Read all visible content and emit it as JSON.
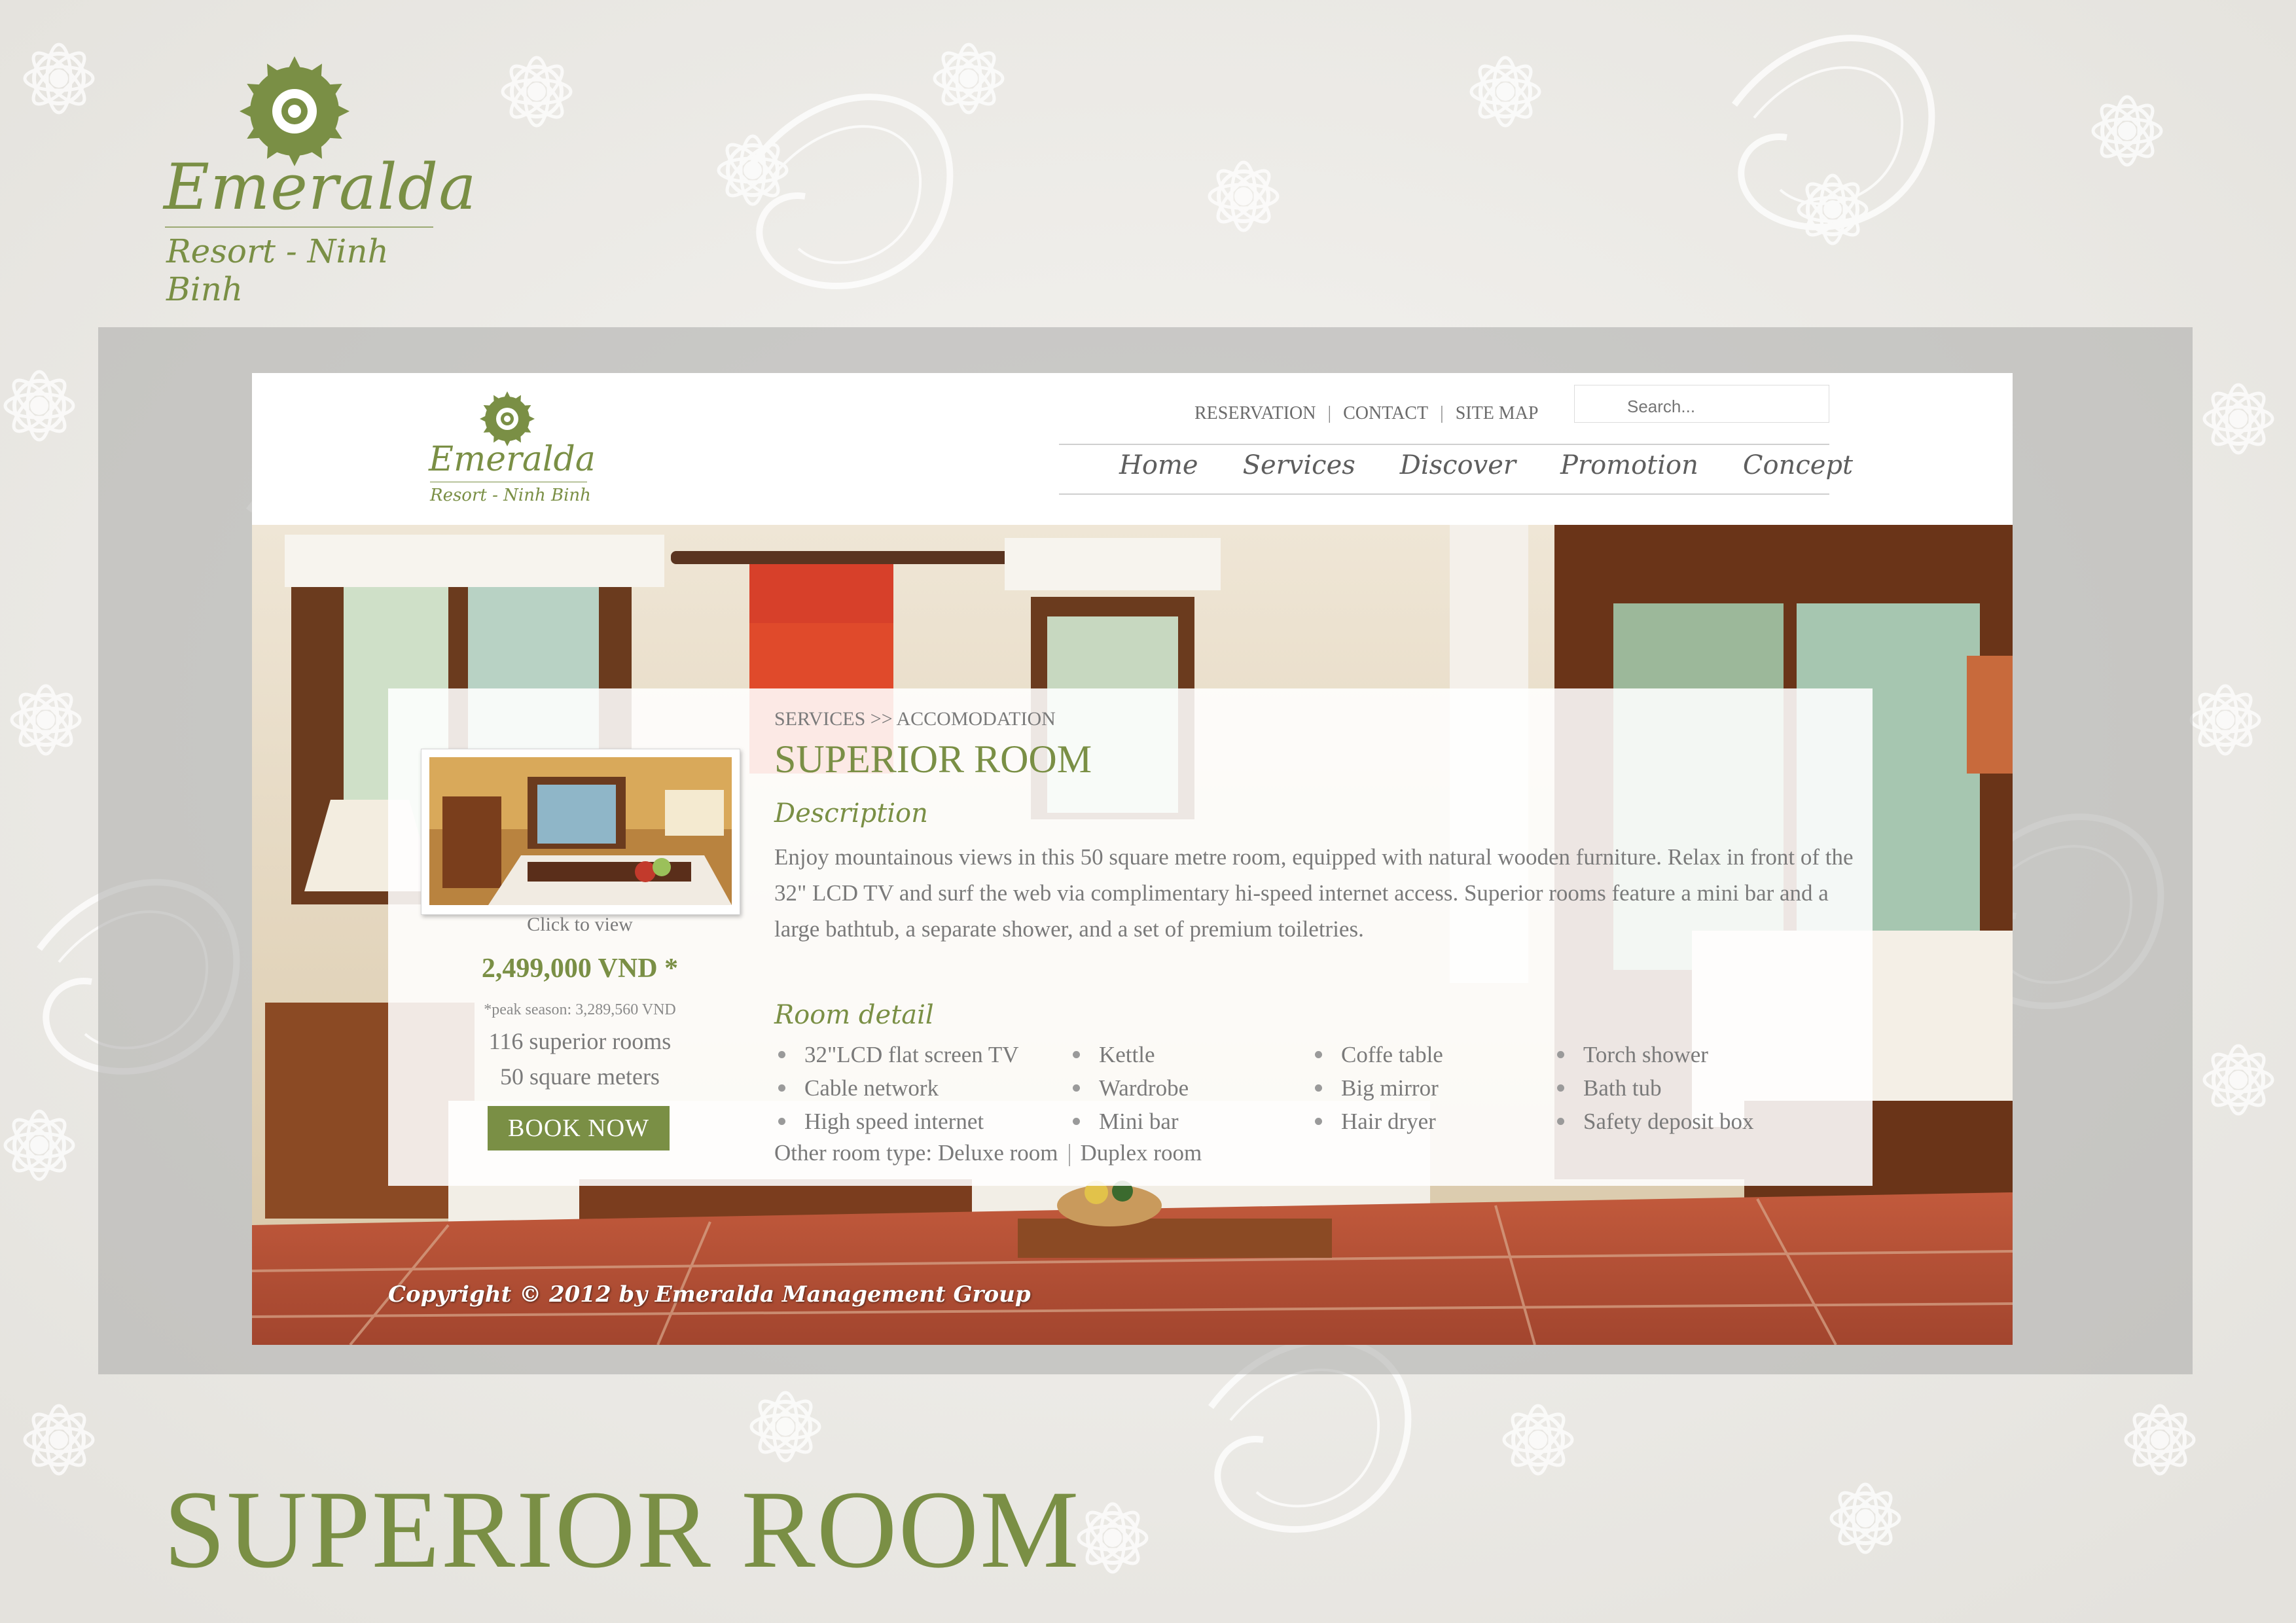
{
  "slide": {
    "brand_name": "Emeralda",
    "brand_sub": "Resort - Ninh Binh",
    "title": "SUPERIOR ROOM"
  },
  "colors": {
    "accent": "#7a8f45",
    "text": "#7a7a7a",
    "frame": "#b8b8b6"
  },
  "site": {
    "logo": {
      "brand": "Emeralda",
      "sub": "Resort - Ninh Binh"
    },
    "top_links": [
      "RESERVATION",
      "CONTACT",
      "SITE MAP"
    ],
    "search_placeholder": "Search...",
    "nav": [
      "Home",
      "Services",
      "Discover",
      "Promotion",
      "Concept"
    ],
    "breadcrumb": "SERVICES >> ACCOMODATION",
    "room": {
      "title": "SUPERIOR ROOM",
      "click_to_view": "Click to view",
      "price": "2,499,000 VND *",
      "peak_note": "*peak season: 3,289,560 VND",
      "room_count": "116 superior rooms",
      "size": "50 square meters",
      "book_label": "BOOK NOW",
      "description_heading": "Description",
      "description": "Enjoy mountainous views in this 50 square metre room, equipped with natural wooden furniture. Relax in front of the 32\" LCD TV and surf the web via complimentary hi-speed internet access. Superior rooms feature a mini bar and a large bathtub, a separate shower, and a set of premium toiletries.",
      "detail_heading": "Room detail",
      "details": [
        [
          "32\"LCD flat screen TV",
          "Cable network",
          "High speed internet"
        ],
        [
          "Kettle",
          "Wardrobe",
          "Mini bar"
        ],
        [
          "Coffe table",
          "Big mirror",
          "Hair dryer"
        ],
        [
          "Torch shower",
          "Bath tub",
          "Safety deposit box"
        ]
      ],
      "other_label": "Other room type:",
      "other_types": [
        "Deluxe room",
        "Duplex room"
      ]
    },
    "copyright": "Copyright © 2012 by Emeralda Management Group"
  }
}
